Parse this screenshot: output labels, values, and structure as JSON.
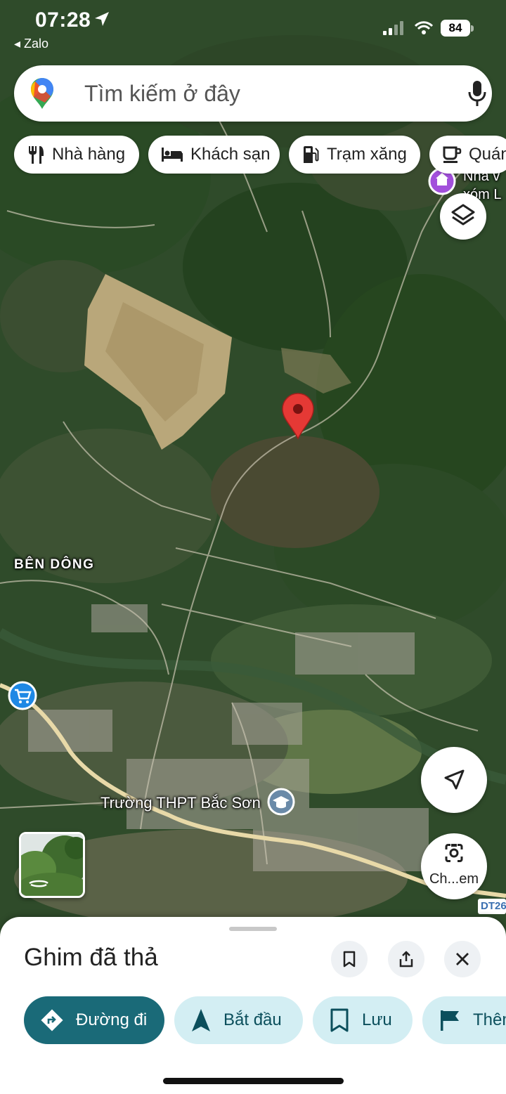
{
  "status_bar": {
    "time": "07:28",
    "back_app": "◂ Zalo",
    "battery": "84"
  },
  "search": {
    "placeholder": "Tìm kiếm ở đây",
    "icons": {
      "logo": "google-maps-pin-icon",
      "voice": "mic-icon"
    }
  },
  "categories": [
    {
      "label": "Nhà hàng",
      "icon": "restaurant-icon"
    },
    {
      "label": "Khách sạn",
      "icon": "hotel-icon"
    },
    {
      "label": "Trạm xăng",
      "icon": "gas-station-icon"
    },
    {
      "label": "Quán",
      "icon": "coffee-icon"
    }
  ],
  "map": {
    "labels": {
      "area": "BÊN DÔNG",
      "school": "Trường THPT Bắc Sơn",
      "place_line1": "Nhà v",
      "place_line2": "xóm L",
      "road_shield": "DT26"
    },
    "controls": {
      "layers": "layers-icon",
      "navigate": "navigation-arrow-icon",
      "camera_label": "Ch...em"
    },
    "pin_color": "#e53935"
  },
  "sheet": {
    "title": "Ghim đã thả",
    "actions": [
      {
        "label": "Đường đi",
        "icon": "directions-icon"
      },
      {
        "label": "Bắt đầu",
        "icon": "navigation-start-icon"
      },
      {
        "label": "Lưu",
        "icon": "bookmark-icon"
      },
      {
        "label": "Thêm",
        "icon": "flag-icon"
      }
    ]
  },
  "colors": {
    "accent": "#1a6a78",
    "action_bg": "#d3eef3",
    "road": "#e8d9a8"
  }
}
